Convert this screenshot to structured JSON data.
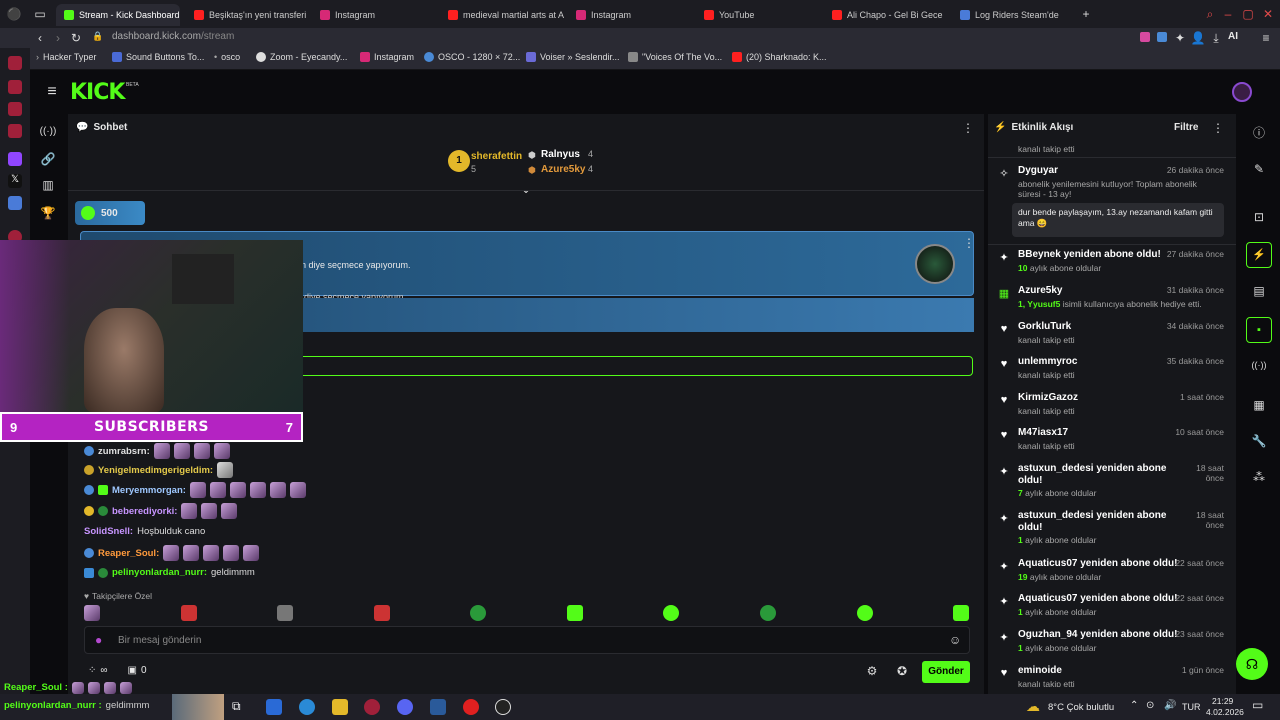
{
  "browser": {
    "tabs": [
      {
        "label": "Stream - Kick Dashboard",
        "color": "#53fc18"
      },
      {
        "label": "Beşiktaş'ın yeni transferi",
        "color": "#ff2020"
      },
      {
        "label": "Instagram",
        "color": "#d62976"
      },
      {
        "label": "medieval martial arts at A",
        "color": "#ff2020"
      },
      {
        "label": "Instagram",
        "color": "#d62976"
      },
      {
        "label": "YouTube",
        "color": "#ff2020"
      },
      {
        "label": "Ali Chapo - Gel Bi Gece",
        "color": "#ff2020"
      },
      {
        "label": "Log Riders Steam'de",
        "color": "#4a7bd8"
      }
    ],
    "url_domain": "dashboard.kick.com",
    "url_path": "/stream",
    "bookmarks": [
      "Hacker Typer",
      "Sound Buttons To...",
      "osco",
      "Zoom - Eyecandy...",
      "Instagram",
      "OSCO - 1280 × 72...",
      "Voiser » Seslendir...",
      "\"Voices Of The Vo...",
      "(20) Sharknado: K..."
    ],
    "ai_label": "AI"
  },
  "kick": {
    "logo": "KICK",
    "logo_beta": "BETA"
  },
  "chat": {
    "title": "Sohbet",
    "leaderboard": {
      "top": {
        "rank": "1",
        "name": "sherafettin",
        "count": "5"
      },
      "second": {
        "name": "Ralnyus",
        "count": "4"
      },
      "third": {
        "name": "Azure5ky",
        "count": "4"
      }
    },
    "kicks_count": "500",
    "pinned_text": "n diye seçmece yapıyorum.",
    "pinned_text_2": "diye seçmece yapıyorum.",
    "overlay_subs_left": "9",
    "overlay_subs_label": "SUBSCRIBERS",
    "overlay_subs_right": "7",
    "messages": [
      {
        "user": "zumrabsrn:",
        "color": "#e0e0e0",
        "text": ""
      },
      {
        "user": "Yenigelmedimgerigeldim:",
        "color": "#e3c94a",
        "text": ""
      },
      {
        "user": "Meryemmorgan:",
        "color": "#9fc8ff",
        "text": ""
      },
      {
        "user": "beberediyorki:",
        "color": "#c795ff",
        "text": ""
      },
      {
        "user": "SolidSnell:",
        "color": "#c795ff",
        "text": "Hoşbulduk cano"
      },
      {
        "user": "Reaper_Soul:",
        "color": "#ff9a3c",
        "text": ""
      },
      {
        "user": "pelinyonlardan_nurr:",
        "color": "#53fc18",
        "text": "geldimmm"
      }
    ],
    "followers_only_label": "Takipçilere Özel",
    "input_placeholder": "Bir mesaj gönderin",
    "send_label": "Gönder",
    "viewer_label": "∞",
    "points": "0"
  },
  "activity": {
    "title": "Etkinlik Akışı",
    "filter_label": "Filtre",
    "top_sub": "kanalı takip etti",
    "items": [
      {
        "name": "Dyguyar",
        "time": "26 dakika önce",
        "sub": "abonelik yenilemesini kutluyor! Toplam abonelik süresi - 13 ay!",
        "quote": "dur bende paylaşayım, 13.ay nezamandı kafam gitti ama 😄"
      },
      {
        "name": "BBeynek yeniden abone oldu!",
        "time": "27 dakika önce",
        "sub_bold": "10",
        "sub": "aylık abone oldular"
      },
      {
        "name": "Azure5ky",
        "time": "31 dakika önce",
        "sub_bold": "1, Yyusuf5",
        "sub": "isimli kullanıcıya abonelik hediye etti."
      },
      {
        "name": "GorkluTurk",
        "time": "34 dakika önce",
        "sub": "kanalı takip etti"
      },
      {
        "name": "unlemmyroc",
        "time": "35 dakika önce",
        "sub": "kanalı takip etti"
      },
      {
        "name": "KirmizGazoz",
        "time": "1 saat önce",
        "sub": "kanalı takip etti"
      },
      {
        "name": "M47iasx17",
        "time": "10 saat önce",
        "sub": "kanalı takip etti"
      },
      {
        "name": "astuxun_dedesi yeniden abone oldu!",
        "time": "18 saat önce",
        "sub_bold": "7",
        "sub": "aylık abone oldular"
      },
      {
        "name": "astuxun_dedesi yeniden abone oldu!",
        "time": "18 saat önce",
        "sub_bold": "1",
        "sub": "aylık abone oldular"
      },
      {
        "name": "Aquaticus07 yeniden abone oldu!",
        "time": "22 saat önce",
        "sub_bold": "19",
        "sub": "aylık abone oldular"
      },
      {
        "name": "Aquaticus07 yeniden abone oldu!",
        "time": "22 saat önce",
        "sub_bold": "1",
        "sub": "aylık abone oldular"
      },
      {
        "name": "Oguzhan_94 yeniden abone oldu!",
        "time": "23 saat önce",
        "sub_bold": "1",
        "sub": "aylık abone oldular"
      },
      {
        "name": "eminoide",
        "time": "1 gün önce",
        "sub": "kanalı takip etti"
      }
    ]
  },
  "overlay_bottom": {
    "line1_user": "Reaper_Soul :",
    "line2_user": "pelinyonlardan_nurr :",
    "line2_text": "geldimmm"
  },
  "taskbar": {
    "weather": "8°C  Çok bulutlu",
    "lang": "TUR",
    "time": "21:29",
    "date": "4.02.2026"
  }
}
